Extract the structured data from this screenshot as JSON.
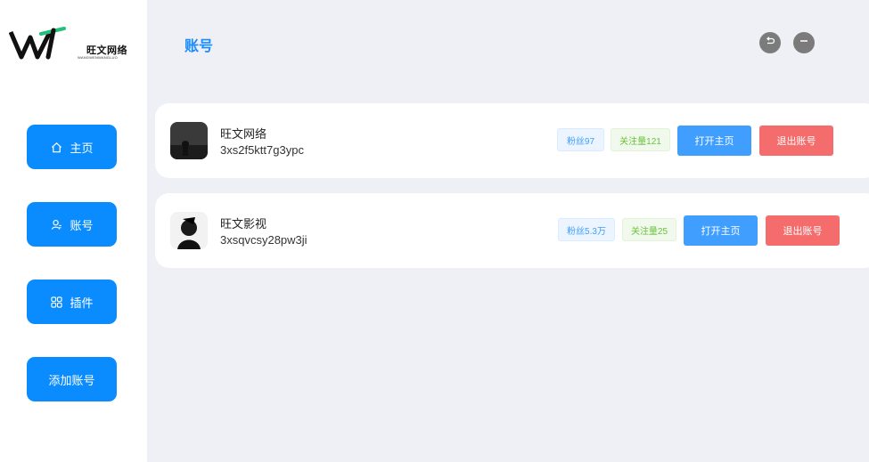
{
  "logo": {
    "text": "旺文网络",
    "subtext": "WANGWENWANGLUO"
  },
  "sidebar": {
    "items": [
      {
        "label": "主页",
        "icon": "home-icon"
      },
      {
        "label": "账号",
        "icon": "user-icon"
      },
      {
        "label": "插件",
        "icon": "grid-icon"
      },
      {
        "label": "添加账号"
      }
    ]
  },
  "header": {
    "title": "账号"
  },
  "window_controls": {
    "back_icon": "undo-icon",
    "minimize_icon": "minimize-icon"
  },
  "accounts": [
    {
      "name": "旺文网络",
      "id": "3xs2f5ktt7g3ypc",
      "fans": "粉丝97",
      "follows": "关注量121",
      "open_label": "打开主页",
      "logout_label": "退出账号"
    },
    {
      "name": "旺文影视",
      "id": "3xsqvcsy28pw3ji",
      "fans": "粉丝5.3万",
      "follows": "关注量25",
      "open_label": "打开主页",
      "logout_label": "退出账号"
    }
  ],
  "colors": {
    "primary": "#0a8cff",
    "title": "#1a8cff",
    "open_button": "#409eff",
    "logout_button": "#f56c6c",
    "background": "#eef0f5"
  }
}
